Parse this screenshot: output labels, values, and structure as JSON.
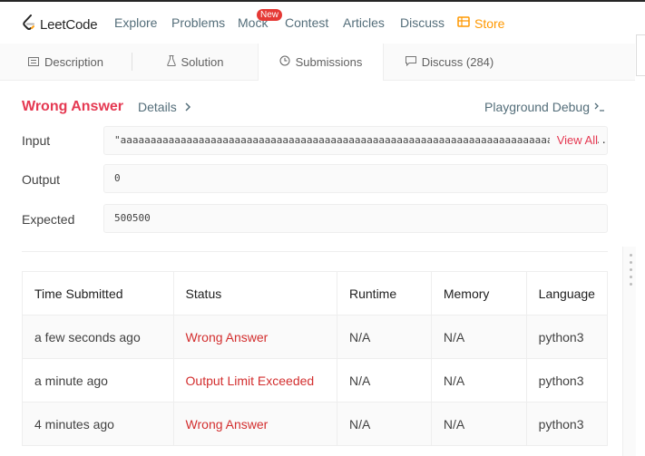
{
  "nav": {
    "logo_text": "LeetCode",
    "items": [
      "Explore",
      "Problems",
      "Mock",
      "Contest",
      "Articles",
      "Discuss"
    ],
    "new_badge": "New",
    "store": "Store"
  },
  "tabs": {
    "description": "Description",
    "solution": "Solution",
    "submissions": "Submissions",
    "discuss": "Discuss (284)"
  },
  "result": {
    "status": "Wrong Answer",
    "details": "Details",
    "playground": "Playground Debug",
    "input_label": "Input",
    "input_value": "\"aaaaaaaaaaaaaaaaaaaaaaaaaaaaaaaaaaaaaaaaaaaaaaaaaaaaaaaaaaaaaaaaaaaaaaaaaaaaaaa...",
    "view_all": "View All",
    "output_label": "Output",
    "output_value": "0",
    "expected_label": "Expected",
    "expected_value": "500500"
  },
  "table": {
    "headers": [
      "Time Submitted",
      "Status",
      "Runtime",
      "Memory",
      "Language"
    ],
    "rows": [
      [
        "a few seconds ago",
        "Wrong Answer",
        "N/A",
        "N/A",
        "python3"
      ],
      [
        "a minute ago",
        "Output Limit Exceeded",
        "N/A",
        "N/A",
        "python3"
      ],
      [
        "4 minutes ago",
        "Wrong Answer",
        "N/A",
        "N/A",
        "python3"
      ]
    ]
  },
  "colors": {
    "accent_red": "#e53952",
    "status_red": "#d32f2f",
    "store_orange": "#ff9800",
    "nav_text": "#546e7a"
  }
}
